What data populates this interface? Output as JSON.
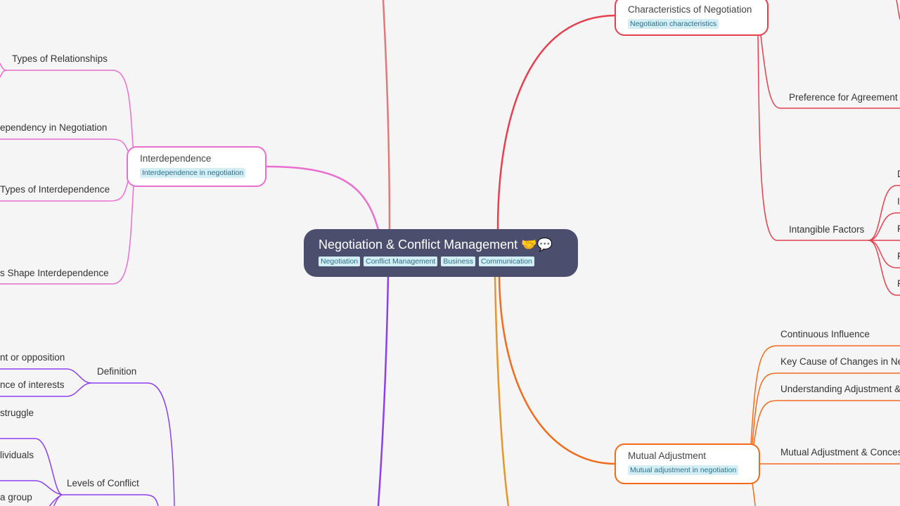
{
  "root": {
    "title": "Negotiation & Conflict Management",
    "emoji": "🤝💬",
    "tags": [
      "Negotiation",
      "Conflict Management",
      "Business",
      "Communication"
    ]
  },
  "branches": {
    "interdependence": {
      "title": "Interdependence",
      "tag": "Interdependence in negotiation",
      "color": "#e86fcf",
      "children": [
        "Types of Relationships",
        "ependency in Negotiation",
        "Types of Interdependence",
        "s Shape Interdependence"
      ]
    },
    "conflict": {
      "color": "#8b3ff0",
      "definition": {
        "title": "Definition",
        "children": [
          "nt or opposition",
          "nce of interests"
        ]
      },
      "struggle": "struggle",
      "levels": {
        "title": "Levels of Conflict",
        "children": [
          "lividuals",
          "a group"
        ]
      }
    },
    "characteristics": {
      "title": "Characteristics of Negotiation",
      "tag": "Negotiation characteristics",
      "color": "#e5404f",
      "children": [
        "Preference for Agreement o",
        "Intangible Factors"
      ],
      "intangible_children": [
        "D",
        "I",
        "F",
        "F",
        "F"
      ]
    },
    "mutual": {
      "title": "Mutual Adjustment",
      "tag": "Mutual adjustment in negotiation",
      "color": "#f26a1b",
      "children": [
        "Continuous Influence",
        "Key Cause of Changes in Neg",
        "Understanding Adjustment &",
        "Mutual Adjustment & Conces"
      ]
    },
    "top_link_color": "#e07a7a",
    "bottom_orange_color": "#e6952a"
  }
}
